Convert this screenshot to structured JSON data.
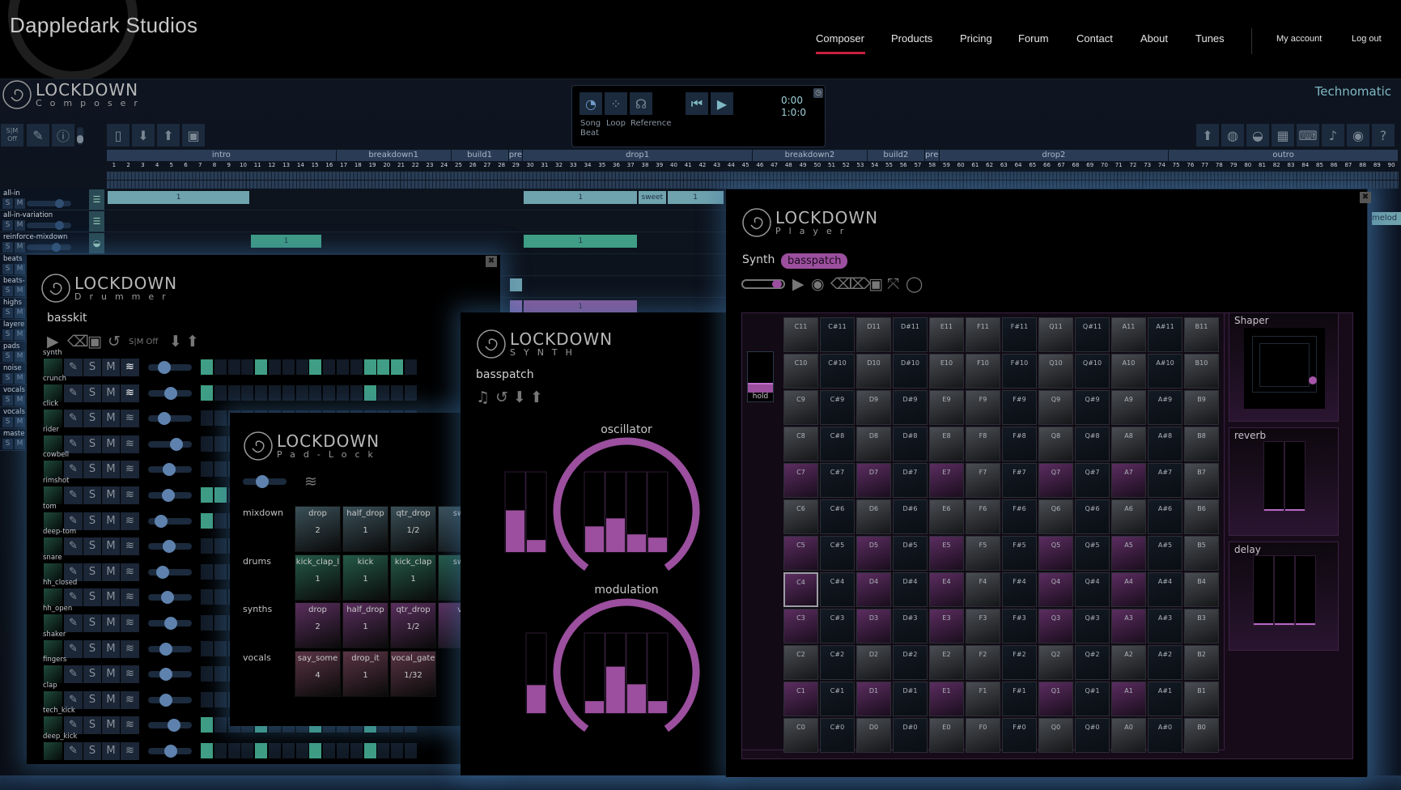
{
  "site": {
    "title": "Dappledark Studios",
    "nav": [
      "Composer",
      "Products",
      "Pricing",
      "Forum",
      "Contact",
      "About",
      "Tunes"
    ],
    "active_nav": "Composer",
    "account": [
      "My account",
      "Log out"
    ],
    "accent": "#c8213f"
  },
  "composer": {
    "logo": "LOCKDOWN",
    "subtitle": "Composer",
    "project": "Technomatic",
    "sm_label": [
      "S|M",
      "Off"
    ],
    "transport": {
      "song": "Song",
      "loop": "Loop",
      "reference": "Reference",
      "beat": "Beat",
      "time": "0:00",
      "position": "1:0:0"
    },
    "left_tools": [
      "edit-icon",
      "info-icon",
      "new-file-icon",
      "download-icon",
      "upload-icon",
      "gift-icon"
    ],
    "right_tools": [
      "upload-icon",
      "globe-icon",
      "drum-icon",
      "grid-icon",
      "keyboard-icon",
      "microphone-icon",
      "record-icon",
      "help-icon"
    ],
    "timeline": {
      "bars": 90,
      "sections": [
        {
          "name": "intro",
          "start": 1,
          "end": 16
        },
        {
          "name": "breakdown1",
          "start": 17,
          "end": 24
        },
        {
          "name": "build1",
          "start": 25,
          "end": 28
        },
        {
          "name": "pre",
          "start": 29,
          "end": 29
        },
        {
          "name": "drop1",
          "start": 30,
          "end": 45
        },
        {
          "name": "breakdown2",
          "start": 46,
          "end": 53
        },
        {
          "name": "build2",
          "start": 54,
          "end": 57
        },
        {
          "name": "pre",
          "start": 58,
          "end": 58
        },
        {
          "name": "drop2",
          "start": 59,
          "end": 74
        },
        {
          "name": "outro",
          "start": 75,
          "end": 90
        }
      ],
      "solo": "S",
      "mute": "M",
      "tracks": [
        {
          "name": "all-in",
          "level": 0.8,
          "clips": [
            {
              "start": 1,
              "end": 10,
              "label": "1",
              "color": "#6fa3ae"
            },
            {
              "start": 30,
              "end": 37,
              "label": "1",
              "color": "#6fa3ae"
            },
            {
              "start": 38,
              "end": 39,
              "label": "sweet",
              "color": "#6fa3ae"
            },
            {
              "start": 40,
              "end": 43,
              "label": "1",
              "color": "#6fa3ae"
            }
          ]
        },
        {
          "name": "all-in-variation",
          "level": 0.8,
          "clips": []
        },
        {
          "name": "reinforce-mixdown",
          "level": 0.7,
          "clips": [
            {
              "start": 11,
              "end": 15,
              "label": "1",
              "color": "#3f9e85"
            },
            {
              "start": 30,
              "end": 37,
              "label": "1",
              "color": "#3f9e85"
            }
          ]
        },
        {
          "name": "beats",
          "level": 0.7,
          "clips": []
        },
        {
          "name": "beats-",
          "level": 0.7,
          "clips": [
            {
              "start": 29,
              "end": 29,
              "label": "",
              "color": "#6fa3ae"
            }
          ]
        },
        {
          "name": "highs",
          "level": 0.7,
          "clips": [
            {
              "start": 29,
              "end": 29,
              "label": "",
              "color": "#8a6ab0"
            },
            {
              "start": 30,
              "end": 37,
              "label": "1",
              "color": "#8a5a9e"
            }
          ]
        },
        {
          "name": "layere",
          "level": 0.7,
          "clips": []
        },
        {
          "name": "pads",
          "level": 0.7,
          "clips": []
        },
        {
          "name": "noise",
          "level": 0.7,
          "clips": []
        },
        {
          "name": "vocals",
          "level": 0.7,
          "clips": []
        },
        {
          "name": "vocals",
          "level": 0.7,
          "clips": []
        },
        {
          "name": "maste",
          "level": 0.7,
          "clips": []
        }
      ],
      "side_clip": "melod"
    }
  },
  "drummer": {
    "logo": "LOCKDOWN",
    "subtitle": "Drummer",
    "kit": "basskit",
    "sm_label": "S|M Off",
    "solo": "S",
    "mute": "M",
    "rows": [
      {
        "name": "synth",
        "level": 0.3,
        "layered": true,
        "steps": [
          0,
          4,
          8,
          12,
          13,
          14
        ]
      },
      {
        "name": "crunch",
        "level": 0.5,
        "layered": true,
        "steps": [
          0,
          12
        ]
      },
      {
        "name": "click",
        "level": 0.3,
        "layered": false,
        "steps": []
      },
      {
        "name": "rider",
        "level": 0.67,
        "layered": false,
        "steps": []
      },
      {
        "name": "cowbell",
        "level": 0.45,
        "layered": false,
        "steps": []
      },
      {
        "name": "rimshot",
        "level": 0.42,
        "layered": false,
        "steps": [
          0,
          1
        ]
      },
      {
        "name": "tom",
        "level": 0.2,
        "layered": false,
        "steps": [
          0
        ]
      },
      {
        "name": "deep-tom",
        "level": 0.45,
        "layered": false,
        "steps": []
      },
      {
        "name": "snare",
        "level": 0.25,
        "layered": false,
        "steps": []
      },
      {
        "name": "hh_closed",
        "level": 0.4,
        "layered": false,
        "steps": []
      },
      {
        "name": "hh_open",
        "level": 0.5,
        "layered": false,
        "steps": []
      },
      {
        "name": "shaker",
        "level": 0.36,
        "layered": false,
        "steps": []
      },
      {
        "name": "fingers",
        "level": 0.36,
        "layered": false,
        "steps": []
      },
      {
        "name": "clap",
        "level": 0.34,
        "layered": false,
        "steps": []
      },
      {
        "name": "tech_kick",
        "level": 0.6,
        "layered": false,
        "steps": [
          0,
          4,
          8,
          12
        ]
      },
      {
        "name": "deep_kick",
        "level": 0.5,
        "layered": false,
        "steps": [
          0,
          4,
          8,
          12
        ]
      }
    ]
  },
  "padlock": {
    "logo": "LOCKDOWN",
    "subtitle": "Pad-Lock",
    "level": 0.4,
    "groups": [
      {
        "name": "mixdown",
        "color": "#3a5058",
        "pads": [
          {
            "name": "drop",
            "value": "2"
          },
          {
            "name": "half_drop",
            "value": "1"
          },
          {
            "name": "qtr_drop",
            "value": "1/2"
          },
          {
            "name": "swe",
            "value": ""
          }
        ]
      },
      {
        "name": "drums",
        "color": "#245a48",
        "pads": [
          {
            "name": "kick_clap_l",
            "value": "1"
          },
          {
            "name": "kick",
            "value": "1"
          },
          {
            "name": "kick_clap",
            "value": "1"
          },
          {
            "name": "swe",
            "value": ""
          }
        ]
      },
      {
        "name": "synths",
        "color": "#5a2f5e",
        "pads": [
          {
            "name": "drop",
            "value": "2"
          },
          {
            "name": "half_drop",
            "value": "1"
          },
          {
            "name": "qtr_drop",
            "value": "1/2"
          },
          {
            "name": "vi",
            "value": ""
          }
        ]
      },
      {
        "name": "vocals",
        "color": "#5a3444",
        "pads": [
          {
            "name": "say_some",
            "value": "4"
          },
          {
            "name": "drop_it",
            "value": "1"
          },
          {
            "name": "vocal_gate",
            "value": "1/32"
          }
        ]
      }
    ]
  },
  "synth": {
    "logo": "LOCKDOWN",
    "subtitle": "SYNTH",
    "patch": "basspatch",
    "accent": "#9b4f9e",
    "oscillator": {
      "label": "oscillator",
      "side": [
        0.52,
        0.15
      ],
      "bars": [
        0.32,
        0.42,
        0.22,
        0.18
      ]
    },
    "modulation": {
      "label": "modulation",
      "side": [
        0.35
      ],
      "bars": [
        0.15,
        0.58,
        0.36,
        0.15
      ]
    }
  },
  "player": {
    "logo": "LOCKDOWN",
    "subtitle": "Player",
    "instrument": "Synth",
    "patch": "basspatch",
    "volume": 0.9,
    "hold": "hold",
    "hold_level": 0.25,
    "notes": [
      "C",
      "C#",
      "D",
      "D#",
      "E",
      "F",
      "F#",
      "Q",
      "Q#",
      "A",
      "A#",
      "B"
    ],
    "octaves": [
      11,
      10,
      9,
      8,
      7,
      6,
      5,
      4,
      3,
      2,
      1,
      0
    ],
    "highlighted_octaves": [
      7,
      5,
      4,
      3,
      1
    ],
    "highlighted_notes": [
      "C",
      "D",
      "E",
      "Q",
      "A"
    ],
    "selected": "C4",
    "effects": {
      "shaper": {
        "label": "Shaper"
      },
      "reverb": {
        "label": "reverb",
        "levels": [
          0,
          0
        ]
      },
      "delay": {
        "label": "delay",
        "levels": [
          0,
          0,
          0
        ]
      }
    }
  }
}
